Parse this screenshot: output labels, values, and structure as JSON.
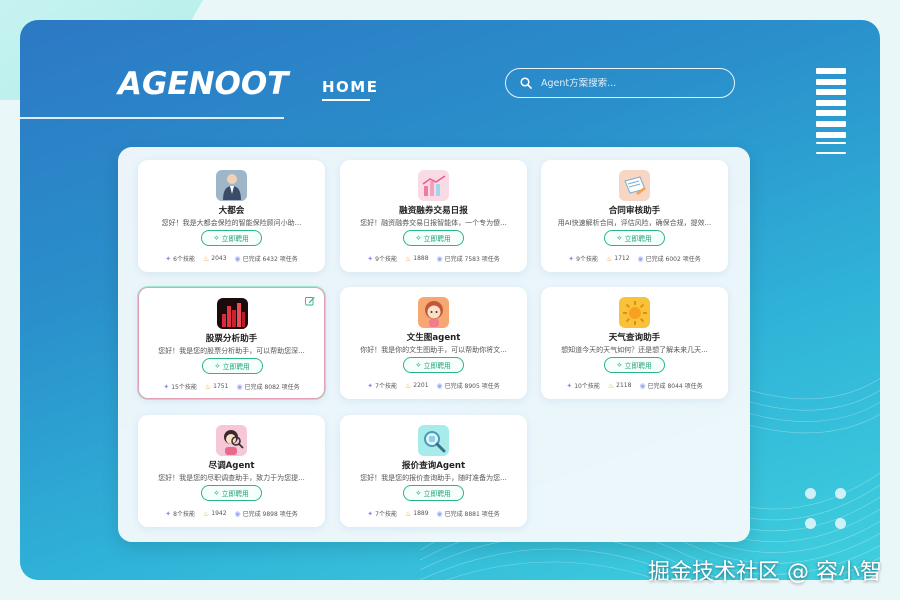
{
  "header": {
    "logo": "AGENOOT",
    "nav_home": "HOME",
    "search_placeholder": "Agent方案搜索..."
  },
  "cards": [
    {
      "title": "大都会",
      "desc": "您好！我是大都会保险的智能保险顾问小助...",
      "button": "立即聘用",
      "skills": "6个技能",
      "heat": "2043",
      "done": "已完成 6432 项任务",
      "avatar_icon": "businessman-avatar-icon"
    },
    {
      "title": "融资融券交易日报",
      "desc": "您好！融资融券交易日报智能体，一个专为傻...",
      "button": "立即聘用",
      "skills": "9个技能",
      "heat": "1888",
      "done": "已完成 7583 项任务",
      "avatar_icon": "chart-report-icon"
    },
    {
      "title": "合同审核助手",
      "desc": "用AI快速解析合同，评估风险，确保合规，提效...",
      "button": "立即聘用",
      "skills": "9个技能",
      "heat": "1712",
      "done": "已完成 6002 项任务",
      "avatar_icon": "contract-document-icon"
    },
    {
      "title": "股票分析助手",
      "desc": "您好！我是您的股票分析助手，可以帮助您深...",
      "button": "立即聘用",
      "skills": "15个技能",
      "heat": "1751",
      "done": "已完成 8082 项任务",
      "avatar_icon": "stock-bars-icon"
    },
    {
      "title": "文生图agent",
      "desc": "你好！我是你的文生图助手，可以帮助你将文...",
      "button": "立即聘用",
      "skills": "7个技能",
      "heat": "2201",
      "done": "已完成 8905 项任务",
      "avatar_icon": "cartoon-girl-icon"
    },
    {
      "title": "天气查询助手",
      "desc": "想知道今天的天气如何？还是想了解未来几天...",
      "button": "立即聘用",
      "skills": "10个技能",
      "heat": "2118",
      "done": "已完成 8044 项任务",
      "avatar_icon": "sun-icon"
    },
    {
      "title": "尽调Agent",
      "desc": "您好！我是您的尽职调查助手，致力于为您提...",
      "button": "立即聘用",
      "skills": "8个技能",
      "heat": "1942",
      "done": "已完成 9898 项任务",
      "avatar_icon": "detective-magnifier-icon"
    },
    {
      "title": "报价查询Agent",
      "desc": "您好！我是您的报价查询助手，随时准备为您...",
      "button": "立即聘用",
      "skills": "7个技能",
      "heat": "1889",
      "done": "已完成 8881 项任务",
      "avatar_icon": "magnifier-search-icon"
    }
  ],
  "watermark": "掘金技术社区 @ 容小智",
  "colors": {
    "accent_green": "#20a476",
    "bg_blue": "#2a90cb",
    "bg_cyan": "#3fd0dd"
  }
}
